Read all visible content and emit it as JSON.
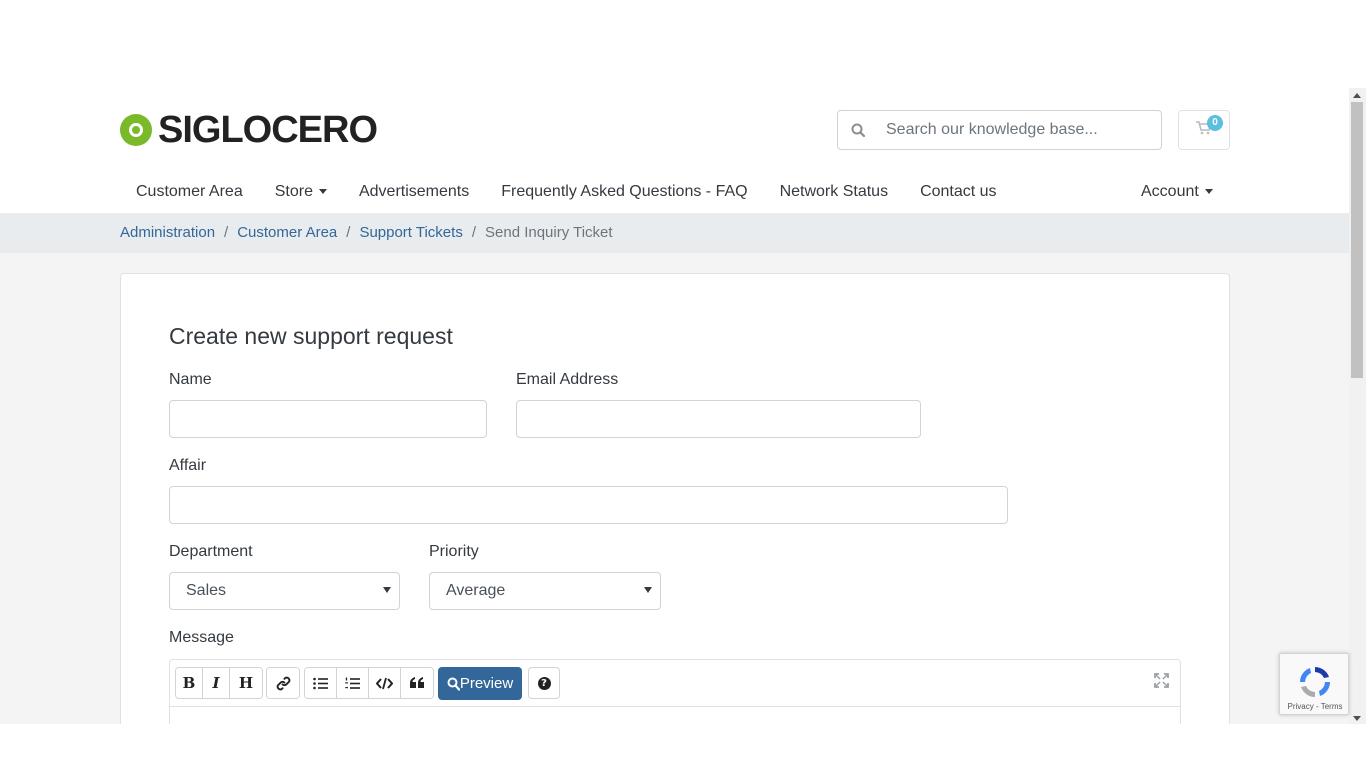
{
  "header": {
    "logo_text": "SIGLOCERO",
    "search": {
      "placeholder": "Search our knowledge base..."
    },
    "cart": {
      "count": "0"
    }
  },
  "nav": {
    "items": [
      {
        "label": "Customer Area",
        "dropdown": false
      },
      {
        "label": "Store",
        "dropdown": true
      },
      {
        "label": "Advertisements",
        "dropdown": false
      },
      {
        "label": "Frequently Asked Questions - FAQ",
        "dropdown": false
      },
      {
        "label": "Network Status",
        "dropdown": false
      },
      {
        "label": "Contact us",
        "dropdown": false
      }
    ],
    "account_label": "Account"
  },
  "breadcrumb": {
    "items": [
      "Administration",
      "Customer Area",
      "Support Tickets"
    ],
    "current": "Send Inquiry Ticket",
    "separator": "/"
  },
  "form": {
    "title": "Create new support request",
    "name_label": "Name",
    "name_value": "",
    "email_label": "Email Address",
    "email_value": "",
    "affair_label": "Affair",
    "affair_value": "",
    "department_label": "Department",
    "department_value": "Sales",
    "priority_label": "Priority",
    "priority_value": "Average",
    "message_label": "Message"
  },
  "editor": {
    "buttons": [
      "B",
      "I",
      "H"
    ],
    "preview_label": "Preview"
  },
  "recaptcha": {
    "footer": "Privacy - Terms"
  },
  "colors": {
    "accent": "#336699",
    "logo_green": "#7ab929",
    "badge": "#5bc0de",
    "breadcrumb_bg": "#e9ecef",
    "page_bg": "#f4f4f4"
  }
}
